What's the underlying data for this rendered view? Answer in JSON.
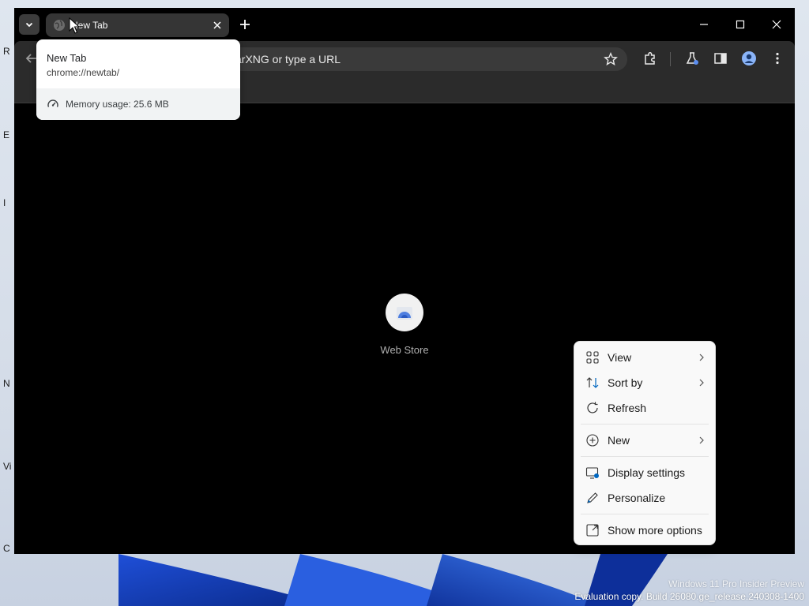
{
  "browser": {
    "tab": {
      "title": "New Tab"
    },
    "omnibox": {
      "placeholder_fragment": "arXNG or type a URL"
    },
    "shortcut": {
      "label": "Web Store"
    }
  },
  "hover_card": {
    "title": "New Tab",
    "url": "chrome://newtab/",
    "memory": "Memory usage: 25.6 MB"
  },
  "context_menu": {
    "items": [
      {
        "label": "View",
        "icon": "grid-icon",
        "submenu": true
      },
      {
        "label": "Sort by",
        "icon": "sort-icon",
        "submenu": true
      },
      {
        "label": "Refresh",
        "icon": "refresh-icon",
        "submenu": false
      },
      {
        "label": "New",
        "icon": "plus-circle-icon",
        "submenu": true
      },
      {
        "label": "Display settings",
        "icon": "display-icon",
        "submenu": false
      },
      {
        "label": "Personalize",
        "icon": "pencil-icon",
        "submenu": false
      },
      {
        "label": "Show more options",
        "icon": "expand-icon",
        "submenu": false
      }
    ]
  },
  "desktop": {
    "icon_letters": [
      "R",
      "E",
      "I",
      "N",
      "Vi",
      "C"
    ],
    "watermark_line1": "Windows 11 Pro Insider Preview",
    "watermark_line2": "Evaluation copy. Build 26080.ge_release.240308-1400"
  },
  "colors": {
    "browser_frame": "#000000",
    "toolbar": "#2b2b2b",
    "active_tab": "#353535",
    "menu_bg": "#f9f9f9",
    "accent_blue": "#0067c0"
  }
}
